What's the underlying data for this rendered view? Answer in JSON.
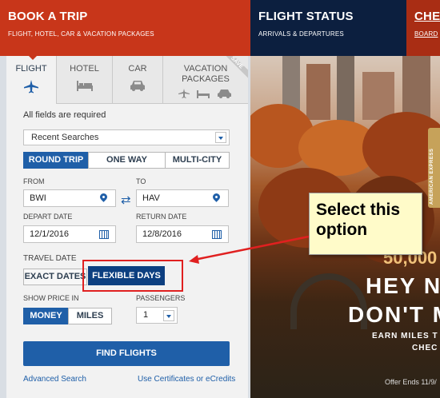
{
  "top_tabs": [
    {
      "title": "BOOK A TRIP",
      "subtitle": "FLIGHT, HOTEL, CAR & VACATION PACKAGES"
    },
    {
      "title": "FLIGHT STATUS",
      "subtitle": "ARRIVALS & DEPARTURES"
    },
    {
      "title": "CHEC",
      "subtitle": "BOARD"
    }
  ],
  "product_tabs": [
    {
      "label": "FLIGHT",
      "icon": "airplane-icon"
    },
    {
      "label": "HOTEL",
      "icon": "bed-icon"
    },
    {
      "label": "CAR",
      "icon": "car-icon"
    },
    {
      "label": "VACATION PACKAGES",
      "icon": "package-icons"
    }
  ],
  "save_badge": "SAVE",
  "form": {
    "required_note": "All fields are required",
    "recent_searches": "Recent Searches",
    "trip_types": [
      "ROUND TRIP",
      "ONE WAY",
      "MULTI-CITY"
    ],
    "from_label": "FROM",
    "from_value": "BWI",
    "to_label": "TO",
    "to_value": "HAV",
    "depart_label": "DEPART DATE",
    "depart_value": "12/1/2016",
    "return_label": "RETURN DATE",
    "return_value": "12/8/2016",
    "travel_date_label": "TRAVEL DATE",
    "travel_date_options": [
      "EXACT DATES",
      "FLEXIBLE DAYS"
    ],
    "show_price_label": "SHOW PRICE IN",
    "price_options": [
      "MONEY",
      "MILES"
    ],
    "passengers_label": "PASSENGERS",
    "passengers_value": "1",
    "find_button": "FIND FLIGHTS",
    "advanced_link": "Advanced Search",
    "certificates_link": "Use Certificates or eCredits"
  },
  "hero": {
    "big": "00",
    "sub": "50,000",
    "line1": "HEY N",
    "line2": "DON'T M",
    "line3": "EARN MILES T",
    "line4": "CHEC",
    "offer": "Offer Ends 11/9/",
    "amex": "AMERICAN EXPRESS"
  },
  "annotation": {
    "text": "Select this option"
  },
  "colors": {
    "brand_red": "#c8361a",
    "brand_navy": "#0c1f3f",
    "accent_blue": "#1f5fa8",
    "annotation_red": "#e02020",
    "callout_yellow": "#fffbc9"
  }
}
